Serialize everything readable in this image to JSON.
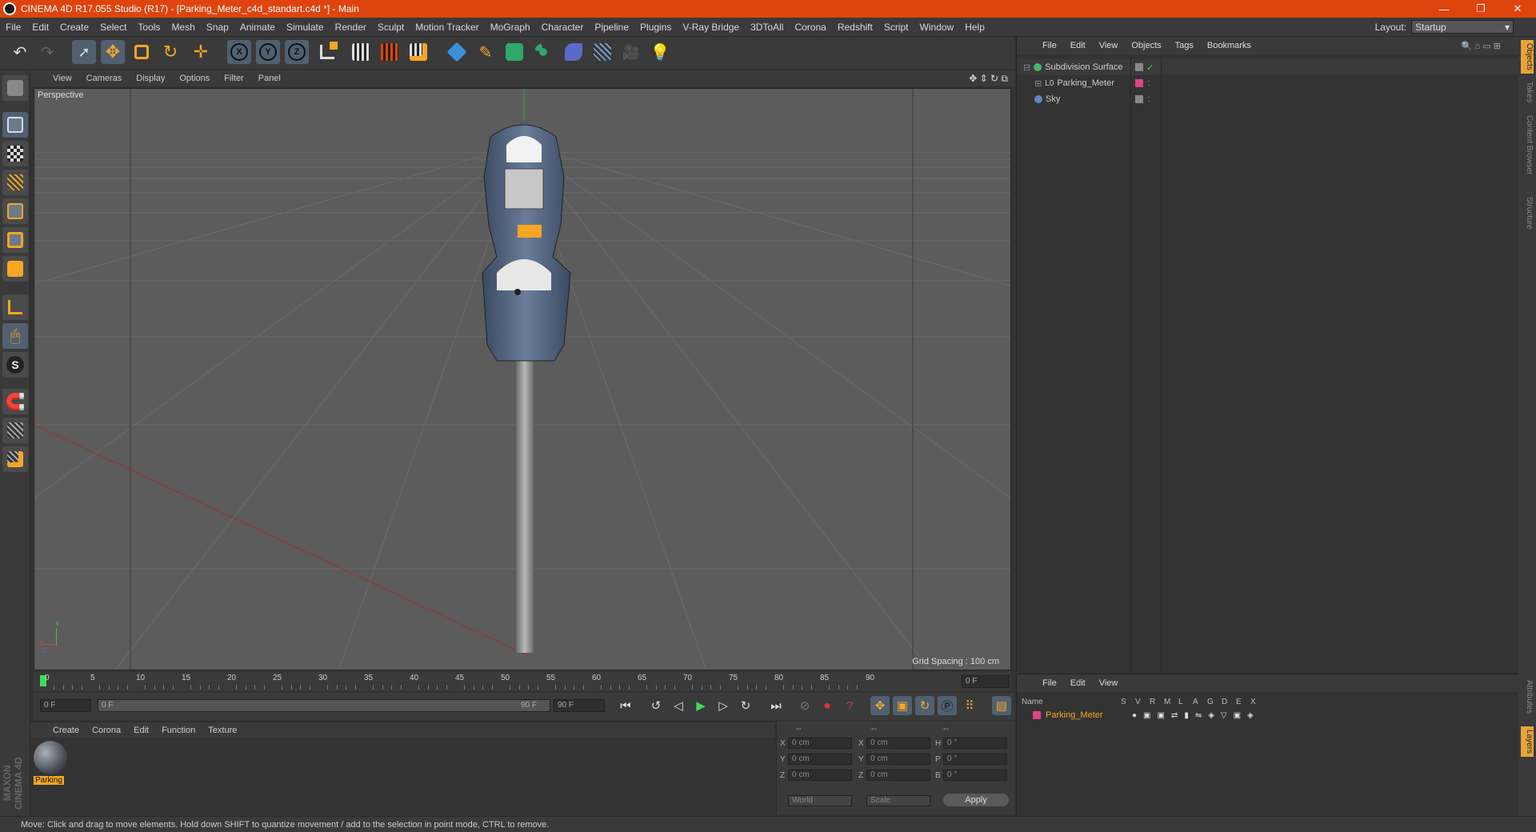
{
  "window": {
    "title": "CINEMA 4D R17.055 Studio (R17) - [Parking_Meter_c4d_standart.c4d *] - Main",
    "minimize": "—",
    "restore": "❐",
    "close": "✕"
  },
  "menu": [
    "File",
    "Edit",
    "Create",
    "Select",
    "Tools",
    "Mesh",
    "Snap",
    "Animate",
    "Simulate",
    "Render",
    "Sculpt",
    "Motion Tracker",
    "MoGraph",
    "Character",
    "Pipeline",
    "Plugins",
    "V-Ray Bridge",
    "3DToAll",
    "Corona",
    "Redshift",
    "Script",
    "Window",
    "Help"
  ],
  "layout": {
    "label": "Layout:",
    "value": "Startup"
  },
  "toolbar": {
    "x": "X",
    "y": "Y",
    "z": "Z",
    "icons": [
      "undo-icon",
      "redo-icon",
      "select-icon",
      "move-icon",
      "scale-icon",
      "rotate-icon",
      "transform-icon",
      "axis-x-icon",
      "axis-y-icon",
      "axis-z-icon",
      "coord-system-icon",
      "render-view-icon",
      "render-picture-queue-icon",
      "render-settings-icon",
      "cube-icon",
      "pen-spline-icon",
      "subdivision-icon",
      "cloner-icon",
      "deformer-icon",
      "floor-icon",
      "camera-icon",
      "light-icon"
    ]
  },
  "viewport": {
    "menu": [
      "View",
      "Cameras",
      "Display",
      "Options",
      "Filter",
      "Panel"
    ],
    "label": "Perspective",
    "grid_spacing": "Grid Spacing : 100 cm",
    "axis": {
      "x": "X",
      "y": "Y",
      "z": "Z"
    }
  },
  "timeline": {
    "ticks": [
      "0",
      "5",
      "10",
      "15",
      "20",
      "25",
      "30",
      "35",
      "40",
      "45",
      "50",
      "55",
      "60",
      "65",
      "70",
      "75",
      "80",
      "85",
      "90"
    ],
    "current_frame": "0 F",
    "start": "0 F",
    "range_start": "0 F",
    "range_end": "90 F",
    "end": "90 F"
  },
  "materials": {
    "menu": [
      "Create",
      "Corona",
      "Edit",
      "Function",
      "Texture"
    ],
    "items": [
      {
        "label": "Parking"
      }
    ]
  },
  "coords": {
    "headers": [
      "--",
      "--",
      "--"
    ],
    "rows": [
      {
        "a": "X",
        "av": "0 cm",
        "b": "X",
        "bv": "0 cm",
        "c": "H",
        "cv": "0 °"
      },
      {
        "a": "Y",
        "av": "0 cm",
        "b": "Y",
        "bv": "0 cm",
        "c": "P",
        "cv": "0 °"
      },
      {
        "a": "Z",
        "av": "0 cm",
        "b": "Z",
        "bv": "0 cm",
        "c": "B",
        "cv": "0 °"
      }
    ],
    "world": "World",
    "scale": "Scale",
    "apply": "Apply"
  },
  "objects": {
    "menu": [
      "File",
      "Edit",
      "View",
      "Objects",
      "Tags",
      "Bookmarks"
    ],
    "items": [
      {
        "name": "Subdivision Surface",
        "color": "#47b36b"
      },
      {
        "name": "Parking_Meter",
        "color": "#c0c0c0"
      },
      {
        "name": "Sky",
        "color": "#5a8ac8"
      }
    ]
  },
  "layers": {
    "menu": [
      "File",
      "Edit",
      "View"
    ],
    "header": {
      "name": "Name",
      "cols": [
        "S",
        "V",
        "R",
        "M",
        "L",
        "A",
        "G",
        "D",
        "E",
        "X"
      ]
    },
    "items": [
      {
        "name": "Parking_Meter",
        "color": "#e0408a"
      }
    ]
  },
  "right_tabs": [
    "Objects",
    "Takes",
    "Content Browser",
    "Structure"
  ],
  "right_tabs_bottom": [
    "Attributes",
    "Layers"
  ],
  "status": "Move: Click and drag to move elements. Hold down SHIFT to quantize movement / add to the selection in point mode, CTRL to remove.",
  "brand": "MAXON CINEMA 4D",
  "colors": {
    "accent": "#e0440e",
    "selection": "#f5a623"
  }
}
